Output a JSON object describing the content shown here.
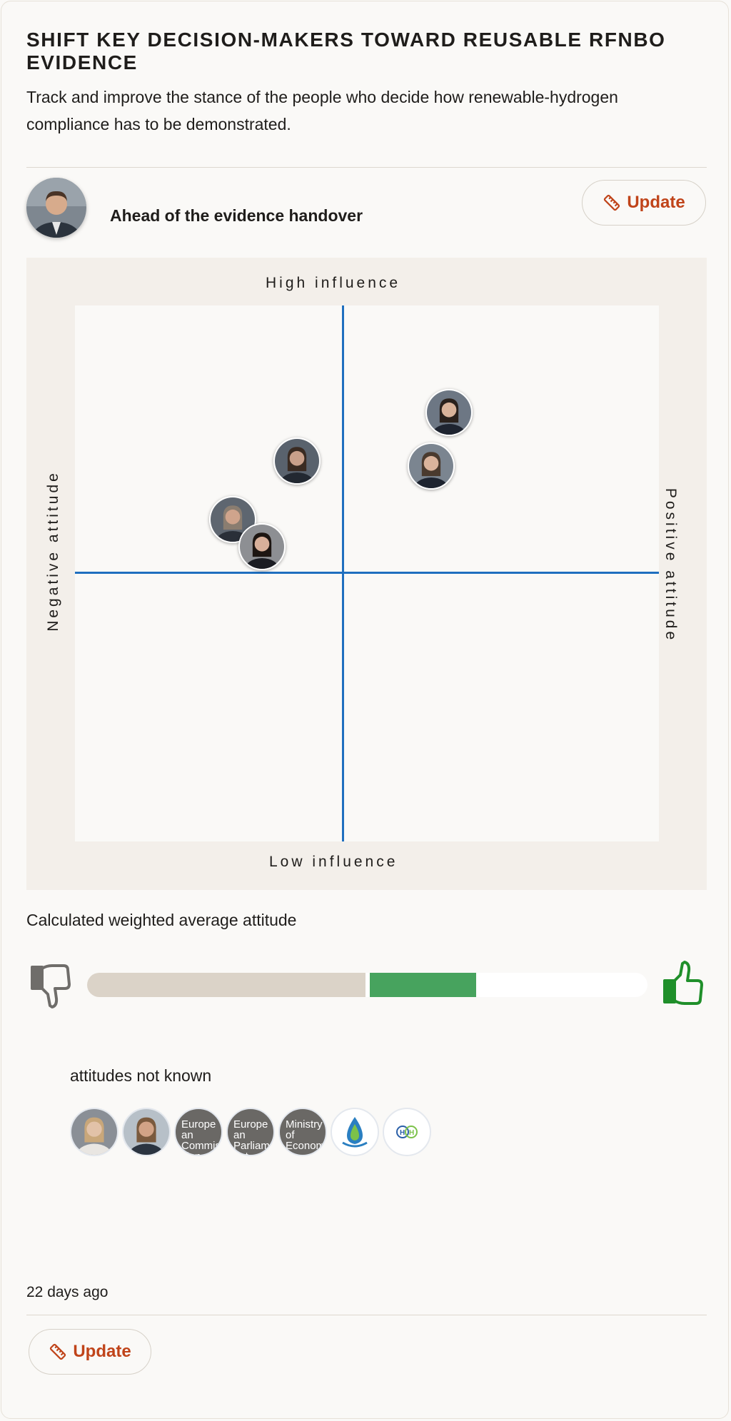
{
  "objective": {
    "title": "SHIFT KEY DECISION-MAKERS TOWARD REUSABLE RFNBO EVIDENCE",
    "description": "Track and improve the stance of the people who decide how renewable-hydrogen compliance has to be demonstrated."
  },
  "owner": {
    "status_text": "Ahead of the evidence handover"
  },
  "actions": {
    "update_label": "Update"
  },
  "matrix": {
    "label_top": "High influence",
    "label_bottom": "Low influence",
    "label_left": "Negative attitude",
    "label_right": "Positive attitude",
    "axis_color": "#1f6fbf",
    "stakeholders": [
      {
        "name": "stakeholder-1",
        "attitude": 0.64,
        "influence": 0.8
      },
      {
        "name": "stakeholder-2",
        "attitude": 0.38,
        "influence": 0.71
      },
      {
        "name": "stakeholder-3",
        "attitude": 0.61,
        "influence": 0.7
      },
      {
        "name": "stakeholder-4",
        "attitude": 0.27,
        "influence": 0.6
      },
      {
        "name": "stakeholder-5",
        "attitude": 0.32,
        "influence": 0.55
      }
    ]
  },
  "average": {
    "label": "Calculated weighted average attitude",
    "negative_icon": "thumbs-down-icon",
    "positive_icon": "thumbs-up-icon",
    "bar_neutral_fraction": 0.5,
    "bar_positive_fraction": 0.19,
    "positive_color": "#47a35e",
    "negative_color": "#dbd3c8"
  },
  "unknown": {
    "label": "attitudes not known",
    "chips": [
      {
        "type": "photo",
        "name": "person-avatar"
      },
      {
        "type": "photo",
        "name": "person-avatar"
      },
      {
        "type": "text",
        "text": "European Commission — DG ENER"
      },
      {
        "type": "text",
        "text": "European Parliament"
      },
      {
        "type": "text",
        "text": "Ministry of Economy"
      },
      {
        "type": "logo",
        "name": "water-drop-logo"
      },
      {
        "type": "logo",
        "name": "h2-logo"
      }
    ]
  },
  "footer": {
    "time_ago": "22 days ago"
  }
}
